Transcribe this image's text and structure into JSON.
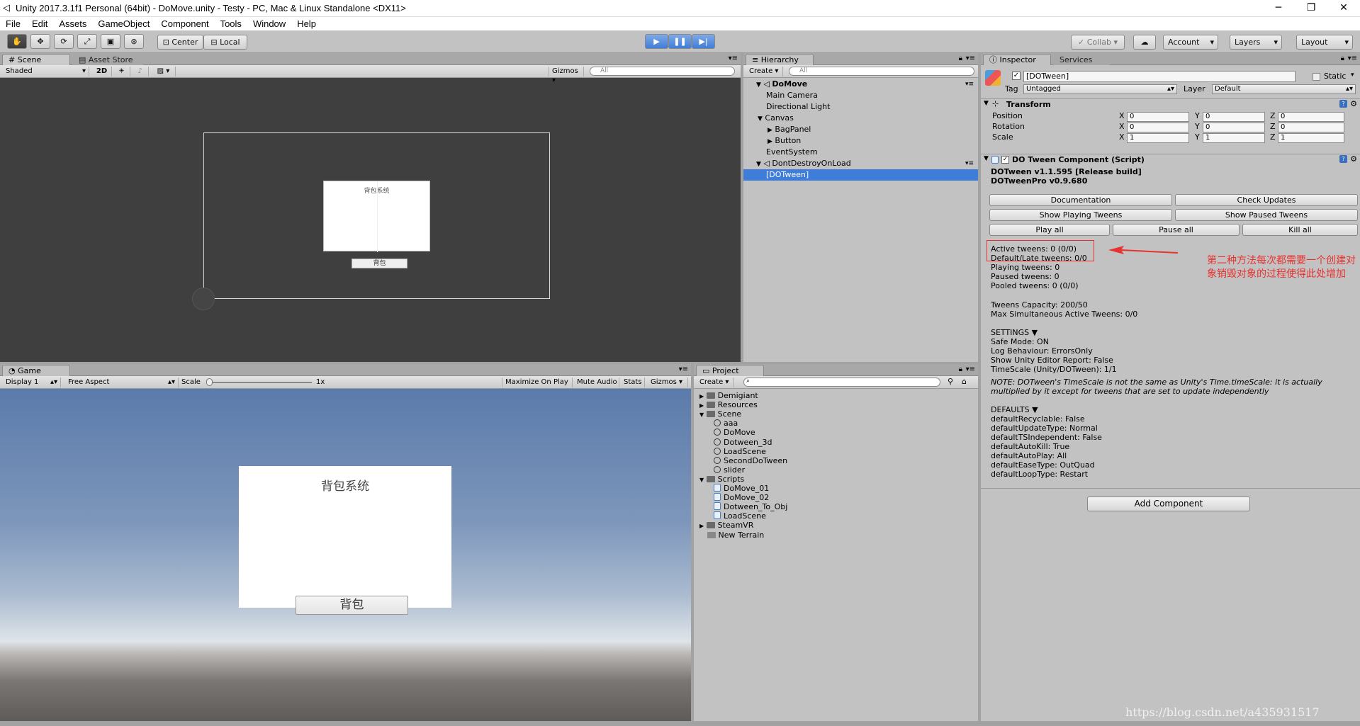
{
  "window": {
    "title": "Unity 2017.3.1f1 Personal (64bit) - DoMove.unity - Testy - PC, Mac & Linux Standalone <DX11>",
    "minimize": "─",
    "maximize": "❐",
    "close": "✕"
  },
  "menu": [
    "File",
    "Edit",
    "Assets",
    "GameObject",
    "Component",
    "Tools",
    "Window",
    "Help"
  ],
  "toolbar": {
    "pivot": "Center",
    "space": "Local",
    "collab": "Collab",
    "account": "Account",
    "layers": "Layers",
    "layout": "Layout"
  },
  "scene": {
    "tab": "Scene",
    "tab2": "Asset Store",
    "shading": "Shaded",
    "mode_2d": "2D",
    "gizmos": "Gizmos",
    "search": "All",
    "panel_title": "背包系统",
    "button": "背包"
  },
  "game": {
    "tab": "Game",
    "display": "Display 1",
    "aspect": "Free Aspect",
    "scale_label": "Scale",
    "scale_value": "1x",
    "maximize": "Maximize On Play",
    "mute": "Mute Audio",
    "stats": "Stats",
    "gizmos": "Gizmos",
    "panel_title": "背包系统",
    "button": "背包"
  },
  "hierarchy": {
    "tab": "Hierarchy",
    "create": "Create",
    "search": "All",
    "items": [
      {
        "label": "DoMove",
        "indent": 0,
        "type": "scene",
        "bold": true
      },
      {
        "label": "Main Camera",
        "indent": 1
      },
      {
        "label": "Directional Light",
        "indent": 1
      },
      {
        "label": "Canvas",
        "indent": 1,
        "expanded": true
      },
      {
        "label": "BagPanel",
        "indent": 2,
        "collapsed": true
      },
      {
        "label": "Button",
        "indent": 2,
        "collapsed": true
      },
      {
        "label": "EventSystem",
        "indent": 1
      },
      {
        "label": "DontDestroyOnLoad",
        "indent": 0,
        "type": "scene"
      },
      {
        "label": "[DOTween]",
        "indent": 1,
        "selected": true
      }
    ]
  },
  "project": {
    "tab": "Project",
    "create": "Create",
    "items": [
      {
        "label": "Demigiant",
        "indent": 0,
        "kind": "folder"
      },
      {
        "label": "Resources",
        "indent": 0,
        "kind": "folder"
      },
      {
        "label": "Scene",
        "indent": 0,
        "kind": "folder",
        "open": true
      },
      {
        "label": "aaa",
        "indent": 1,
        "kind": "scene"
      },
      {
        "label": "DoMove",
        "indent": 1,
        "kind": "scene"
      },
      {
        "label": "Dotween_3d",
        "indent": 1,
        "kind": "scene"
      },
      {
        "label": "LoadScene",
        "indent": 1,
        "kind": "scene"
      },
      {
        "label": "SecondDoTween",
        "indent": 1,
        "kind": "scene"
      },
      {
        "label": "slider",
        "indent": 1,
        "kind": "scene"
      },
      {
        "label": "Scripts",
        "indent": 0,
        "kind": "folder",
        "open": true
      },
      {
        "label": "DoMove_01",
        "indent": 1,
        "kind": "cs"
      },
      {
        "label": "DoMove_02",
        "indent": 1,
        "kind": "cs"
      },
      {
        "label": "Dotween_To_Obj",
        "indent": 1,
        "kind": "cs"
      },
      {
        "label": "LoadScene",
        "indent": 1,
        "kind": "cs"
      },
      {
        "label": "SteamVR",
        "indent": 0,
        "kind": "folder"
      },
      {
        "label": "New Terrain",
        "indent": 0,
        "kind": "terrain"
      }
    ]
  },
  "inspector": {
    "tab": "Inspector",
    "tab2": "Services",
    "name": "[DOTween]",
    "static": "Static",
    "tag_label": "Tag",
    "tag": "Untagged",
    "layer_label": "Layer",
    "layer": "Default",
    "transform": {
      "title": "Transform",
      "rows": [
        {
          "label": "Position",
          "x": "0",
          "y": "0",
          "z": "0"
        },
        {
          "label": "Rotation",
          "x": "0",
          "y": "0",
          "z": "0"
        },
        {
          "label": "Scale",
          "x": "1",
          "y": "1",
          "z": "1"
        }
      ]
    },
    "component": {
      "title": "DO Tween Component (Script)",
      "version1": "DOTween v1.1.595 [Release build]",
      "version2": "DOTweenPro v0.9.680",
      "buttons_row1": [
        "Documentation",
        "Check Updates"
      ],
      "buttons_row2": [
        "Show Playing Tweens",
        "Show Paused Tweens"
      ],
      "buttons_row3": [
        "Play all",
        "Pause all",
        "Kill all"
      ],
      "stats": [
        "Active tweens: 0 (0/0)",
        "Default/Late tweens: 0/0",
        "Playing tweens: 0",
        "Paused tweens: 0",
        "Pooled tweens: 0 (0/0)"
      ],
      "capacity": [
        "Tweens Capacity: 200/50",
        "Max Simultaneous Active Tweens: 0/0"
      ],
      "settings_title": "SETTINGS ▼",
      "settings": [
        "Safe Mode: ON",
        "Log Behaviour: ErrorsOnly",
        "Show Unity Editor Report: False",
        "TimeScale (Unity/DOTween): 1/1"
      ],
      "note": "NOTE: DOTween's TimeScale is not the same as Unity's Time.timeScale: it is actually multiplied by it except for tweens that are set to update independently",
      "defaults_title": "DEFAULTS ▼",
      "defaults": [
        "defaultRecyclable: False",
        "defaultUpdateType: Normal",
        "defaultTSIndependent: False",
        "defaultAutoKill: True",
        "defaultAutoPlay: All",
        "defaultEaseType: OutQuad",
        "defaultLoopType: Restart"
      ]
    },
    "add_component": "Add Component",
    "annotation": "第二种方法每次都需要一个创建对象销毁对象的过程使得此处增加"
  },
  "watermark": "https://blog.csdn.net/a435931517",
  "colors": {
    "selection": "#3e7dd9",
    "annotation": "#e8322f",
    "panel": "#c2c2c2"
  }
}
